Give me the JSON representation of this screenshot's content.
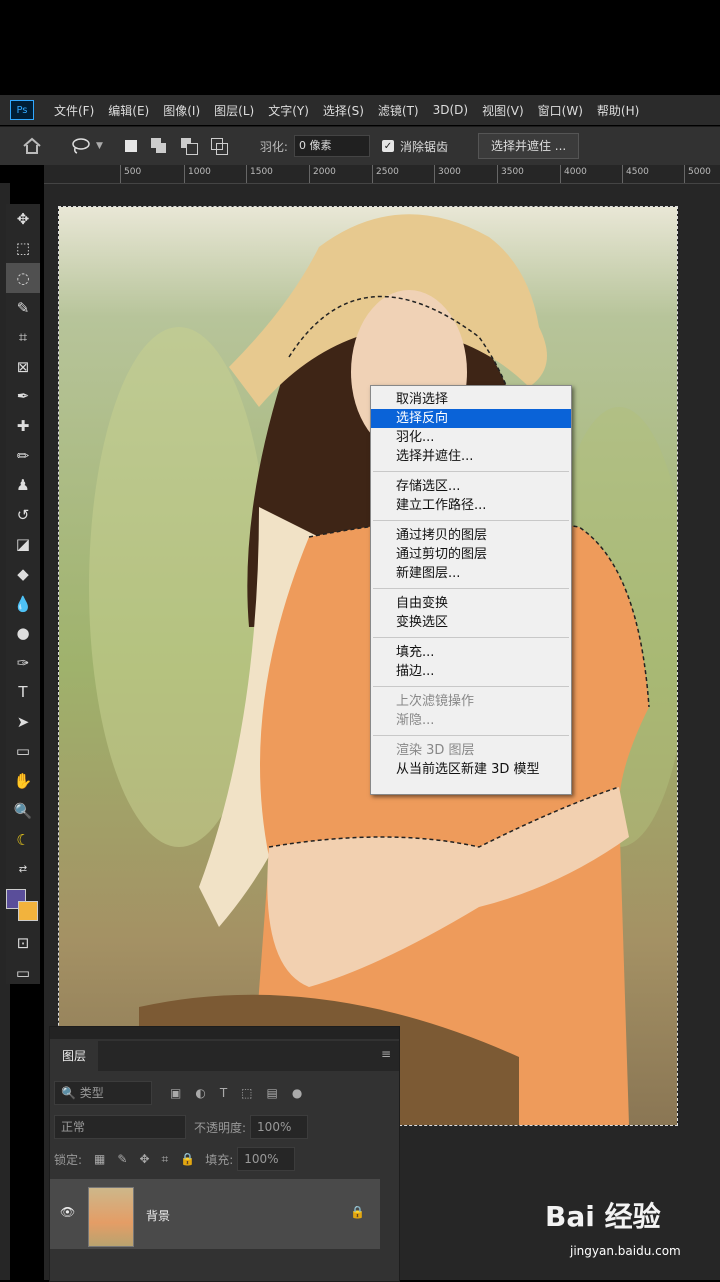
{
  "app": {
    "logo": "Ps"
  },
  "menu": [
    "文件(F)",
    "编辑(E)",
    "图像(I)",
    "图层(L)",
    "文字(Y)",
    "选择(S)",
    "滤镜(T)",
    "3D(D)",
    "视图(V)",
    "窗口(W)",
    "帮助(H)"
  ],
  "options": {
    "feather_label": "羽化:",
    "feather_value": "0 像素",
    "antialias_label": "消除锯齿",
    "antialias_checked": true,
    "refine_button": "选择并遮住 ..."
  },
  "ruler_ticks": [
    "500",
    "1000",
    "1500",
    "2000",
    "2500",
    "3000",
    "3500",
    "4000",
    "4500",
    "5000"
  ],
  "context_menu": {
    "groups": [
      [
        {
          "label": "取消选择"
        },
        {
          "label": "选择反向",
          "highlighted": true
        },
        {
          "label": "羽化..."
        },
        {
          "label": "选择并遮住..."
        }
      ],
      [
        {
          "label": "存储选区..."
        },
        {
          "label": "建立工作路径..."
        }
      ],
      [
        {
          "label": "通过拷贝的图层"
        },
        {
          "label": "通过剪切的图层"
        },
        {
          "label": "新建图层..."
        }
      ],
      [
        {
          "label": "自由变换"
        },
        {
          "label": "变换选区"
        }
      ],
      [
        {
          "label": "填充..."
        },
        {
          "label": "描边..."
        }
      ],
      [
        {
          "label": "上次滤镜操作",
          "disabled": true
        },
        {
          "label": "渐隐...",
          "disabled": true
        }
      ],
      [
        {
          "label": "渲染 3D 图层",
          "disabled": true
        },
        {
          "label": "从当前选区新建 3D 模型"
        }
      ]
    ]
  },
  "layers_panel": {
    "title": "图层",
    "filter_kind": "类型",
    "blend_mode": "正常",
    "opacity_label": "不透明度:",
    "opacity_value": "100%",
    "lock_label": "锁定:",
    "fill_label": "填充:",
    "fill_value": "100%",
    "layer_name": "背景"
  },
  "watermark": {
    "brand": "Bai 经验",
    "url": "jingyan.baidu.com"
  },
  "colors": {
    "foreground": "#5a4e9a",
    "background": "#f2b33d",
    "highlight": "#0a63d8"
  }
}
